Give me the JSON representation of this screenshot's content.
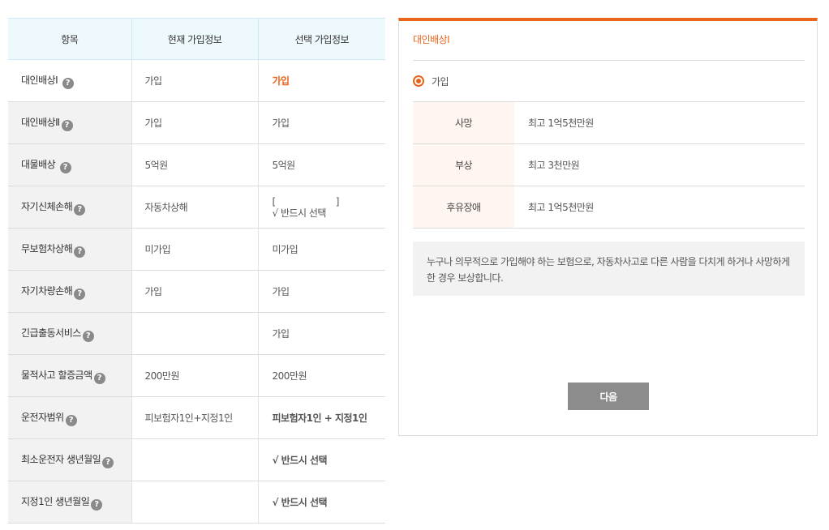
{
  "table": {
    "headers": [
      "항목",
      "현재 가입정보",
      "선택 가입정보"
    ],
    "rows": [
      {
        "item": "대인배상Ⅰ",
        "current": "가입",
        "selected": "가입"
      },
      {
        "item": "대인배상Ⅱ",
        "current": "가입",
        "selected": "가입"
      },
      {
        "item": "대물배상",
        "current": "5억원",
        "selected": "5억원"
      },
      {
        "item": "자기신체손해",
        "current": "자동차상해",
        "selected_open": "[",
        "selected_close": "]",
        "selected": "√ 반드시 선택"
      },
      {
        "item": "무보험차상해",
        "current": "미가입",
        "selected": "미가입"
      },
      {
        "item": "자기차량손해",
        "current": "가입",
        "selected": "가입"
      },
      {
        "item": "긴급출동서비스",
        "current": "",
        "selected": "가입"
      },
      {
        "item": "물적사고 할증금액",
        "current": "200만원",
        "selected": "200만원"
      },
      {
        "item": "운전자범위",
        "current": "피보험자1인+지정1인",
        "selected": "피보험자1인 + 지정1인"
      },
      {
        "item": "최소운전자 생년월일",
        "current": "",
        "selected": "√ 반드시 선택"
      },
      {
        "item": "지정1인 생년월일",
        "current": "",
        "selected": "√ 반드시 선택"
      }
    ],
    "help_glyph": "?"
  },
  "panel": {
    "title": "대인배상Ⅰ",
    "option_label": "가입",
    "details": [
      {
        "label": "사망",
        "value": "최고 1억5천만원"
      },
      {
        "label": "부상",
        "value": "최고 3천만원"
      },
      {
        "label": "후유장애",
        "value": "최고 1억5천만원"
      }
    ],
    "description": "누구나 의무적으로 가입해야 하는 보험으로, 자동차사고로 다른 사람을 다치게 하거나 사망하게 한 경우 보상합니다.",
    "next_label": "다음"
  },
  "colors": {
    "accent": "#e8641b",
    "header_bg": "#eef9fd",
    "item_bg": "#f2f2f2",
    "button": "#8c8c8c"
  }
}
